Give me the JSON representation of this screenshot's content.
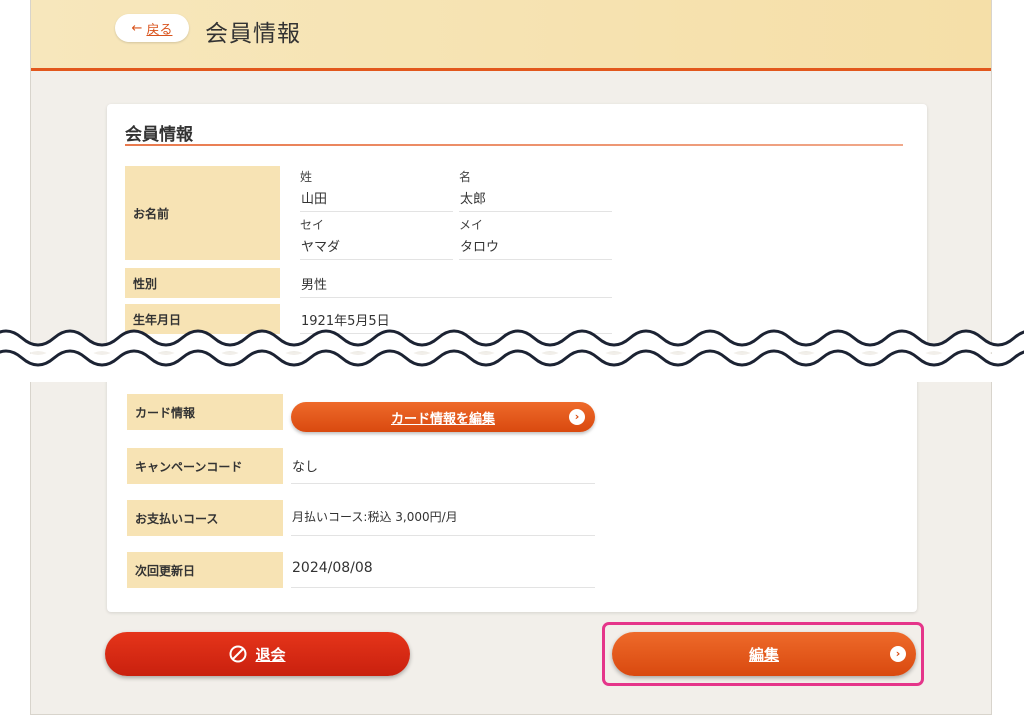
{
  "header": {
    "back_label": "戻る",
    "back_icon": "arrow-left-icon",
    "title": "会員情報"
  },
  "member_section": {
    "title": "会員情報",
    "name_label": "お名前",
    "last_name_label": "姓",
    "last_name": "山田",
    "first_name_label": "名",
    "first_name": "太郎",
    "last_name_kana_label": "セイ",
    "last_name_kana": "ヤマダ",
    "first_name_kana_label": "メイ",
    "first_name_kana": "タロウ",
    "gender_label": "性別",
    "gender": "男性",
    "birth_label": "生年月日",
    "birth": "1921年5月5日"
  },
  "payment_section": {
    "card_label": "カード情報",
    "card_button": "カード情報を編集",
    "campaign_label": "キャンペーンコード",
    "campaign": "なし",
    "course_label": "お支払いコース",
    "course": "月払いコース:税込 3,000円/月",
    "next_label": "次回更新日",
    "next": "2024/08/08"
  },
  "actions": {
    "withdraw_label": "退会",
    "edit_label": "編集"
  },
  "colors": {
    "accent": "#e2571c",
    "label_bg": "#f7e3b4",
    "highlight": "#e5358a",
    "danger": "#d92a14"
  }
}
